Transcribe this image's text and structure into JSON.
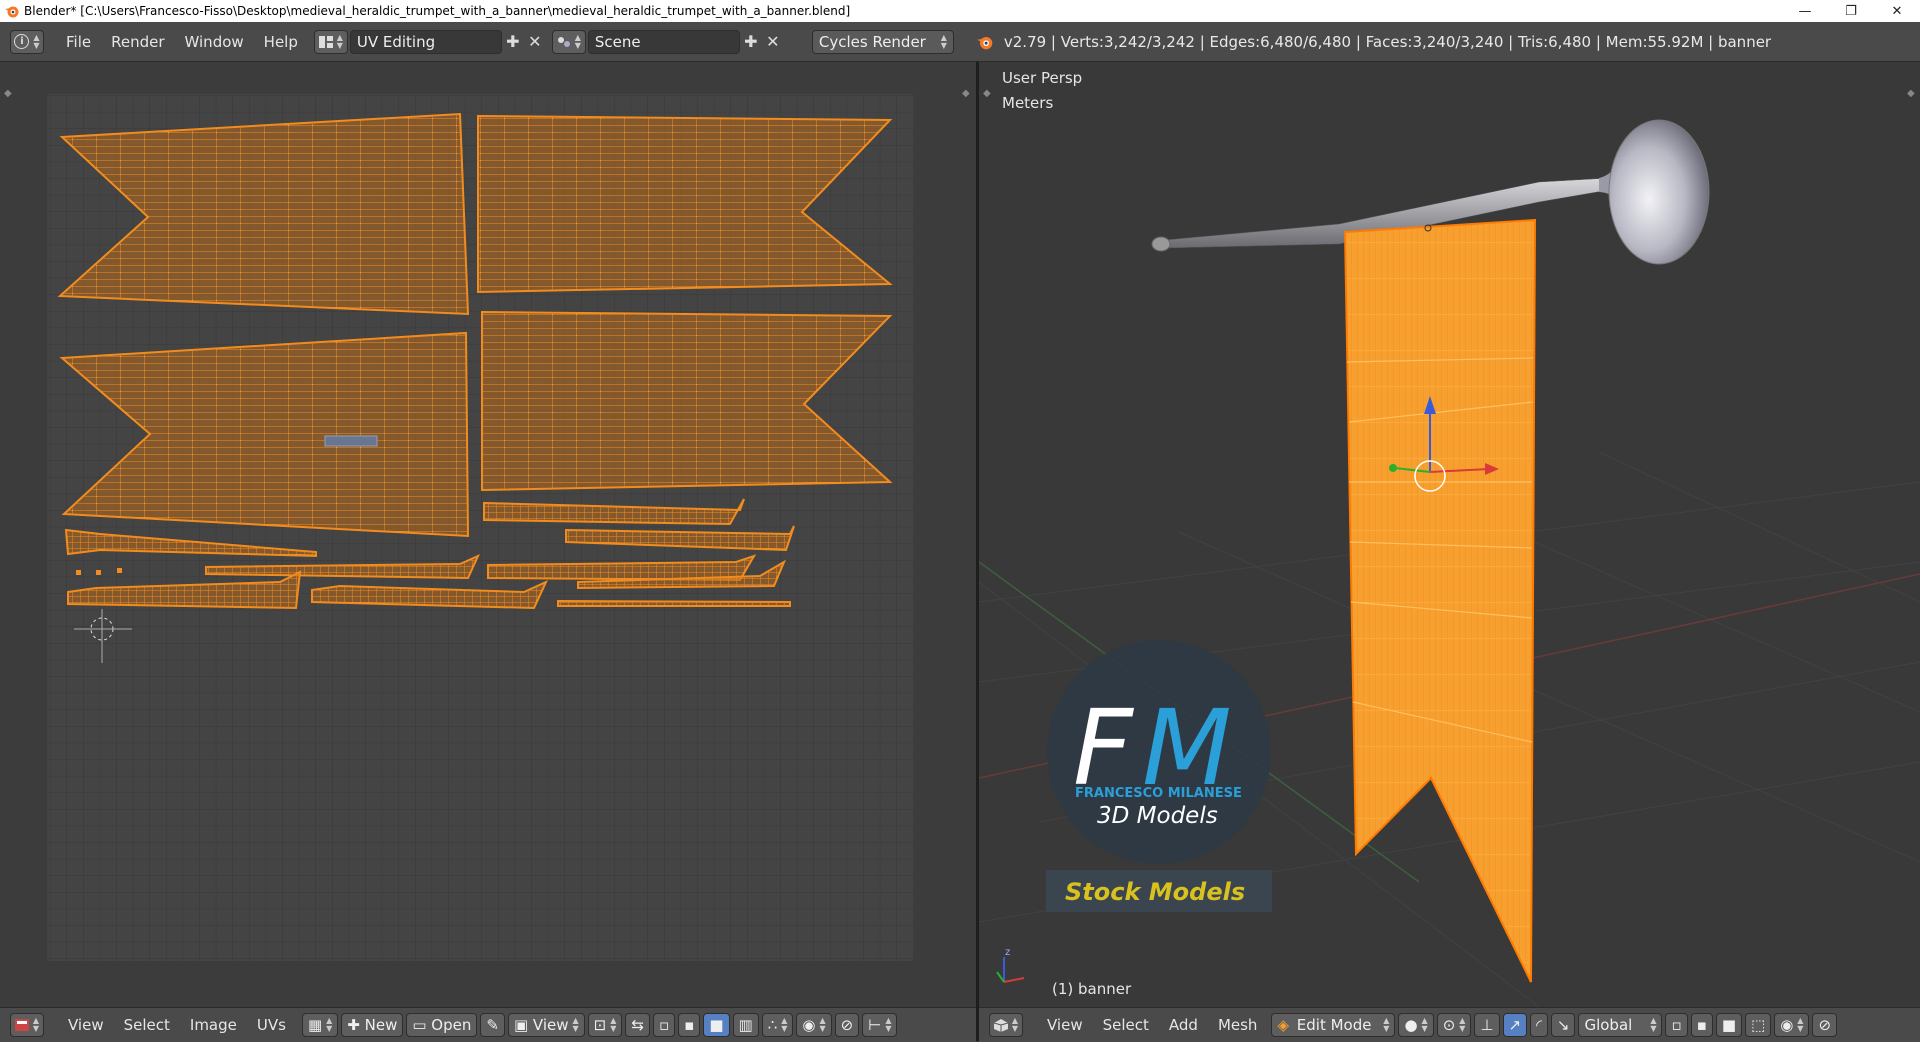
{
  "window": {
    "title": "Blender* [C:\\Users\\Francesco-Fisso\\Desktop\\medieval_heraldic_trumpet_with_a_banner\\medieval_heraldic_trumpet_with_a_banner.blend]",
    "minimize": "—",
    "restore": "❐",
    "close": "✕"
  },
  "info_header": {
    "menus": [
      "File",
      "Render",
      "Window",
      "Help"
    ],
    "layout": "UV Editing",
    "scene": "Scene",
    "engine": "Cycles Render",
    "stats": "v2.79 | Verts:3,242/3,242 | Edges:6,480/6,480 | Faces:3,240/3,240 | Tris:6,480 | Mem:55.92M | banner"
  },
  "viewport": {
    "view_name": "User Persp",
    "units": "Meters",
    "object_label": "(1) banner",
    "watermark": {
      "letters_f": "F",
      "letters_m": "M",
      "name": "FRANCESCO MILANESE",
      "tagline": "3D Models",
      "badge": "Stock Models"
    }
  },
  "uv_footer": {
    "menus": [
      "View",
      "Select",
      "Image",
      "UVs"
    ],
    "new_label": "New",
    "open_label": "Open",
    "view_label": "View"
  },
  "vp_footer": {
    "menus": [
      "View",
      "Select",
      "Add",
      "Mesh"
    ],
    "mode": "Edit Mode",
    "orientation": "Global"
  },
  "colors": {
    "accent_orange": "#f28c1e",
    "selection_blue": "#5680c2",
    "header_bg": "#4a4a4a"
  },
  "icons": {
    "info": "info-icon",
    "layout": "screen-layout-icon",
    "scene": "scene-icon",
    "blender": "blender-logo-icon"
  }
}
